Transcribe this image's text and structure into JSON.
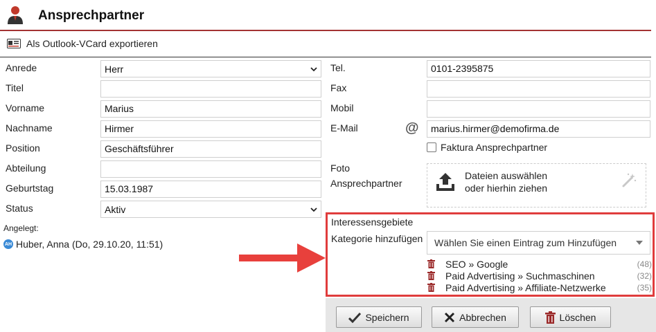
{
  "header": {
    "title": "Ansprechpartner"
  },
  "toolbar": {
    "export_vcard_label": "Als Outlook-VCard exportieren"
  },
  "left_form": {
    "anrede": {
      "label": "Anrede",
      "value": "Herr"
    },
    "titel": {
      "label": "Titel",
      "value": ""
    },
    "vorname": {
      "label": "Vorname",
      "value": "Marius"
    },
    "nachname": {
      "label": "Nachname",
      "value": "Hirmer"
    },
    "position": {
      "label": "Position",
      "value": "Geschäftsführer"
    },
    "abteilung": {
      "label": "Abteilung",
      "value": ""
    },
    "geburtstag": {
      "label": "Geburtstag",
      "value": "15.03.1987"
    },
    "status": {
      "label": "Status",
      "value": "Aktiv"
    }
  },
  "created": {
    "label": "Angelegt:",
    "avatar_initials": "AH",
    "text": "Huber, Anna (Do, 29.10.20, 11:51)"
  },
  "right_form": {
    "tel": {
      "label": "Tel.",
      "value": "0101-2395875"
    },
    "fax": {
      "label": "Fax",
      "value": ""
    },
    "mobil": {
      "label": "Mobil",
      "value": ""
    },
    "email": {
      "label": "E-Mail",
      "value": "marius.hirmer@demofirma.de",
      "icon": "at-icon"
    },
    "faktura_checkbox": {
      "label": "Faktura Ansprechpartner",
      "checked": false
    },
    "photo": {
      "label_line1": "Foto",
      "label_line2": "Ansprechpartner",
      "dropzone_line1": "Dateien auswählen",
      "dropzone_line2": "oder hierhin ziehen"
    }
  },
  "interests": {
    "title": "Interessensgebiete",
    "category_label": "Kategorie hinzufügen",
    "category_placeholder": "Wählen Sie einen Eintrag zum Hinzufügen",
    "highlight_color": "#e03c3c",
    "tags": [
      {
        "label": "SEO » Google",
        "count": "(48)"
      },
      {
        "label": "Paid Advertising » Suchmaschinen",
        "count": "(32)"
      },
      {
        "label": "Paid Advertising » Affiliate-Netzwerke",
        "count": "(35)"
      }
    ]
  },
  "buttons": {
    "save": "Speichern",
    "cancel": "Abbrechen",
    "delete": "Löschen"
  },
  "colors": {
    "accent_rule": "#a33232",
    "arrow": "#e8403c",
    "avatar": "#3a8ad6"
  }
}
